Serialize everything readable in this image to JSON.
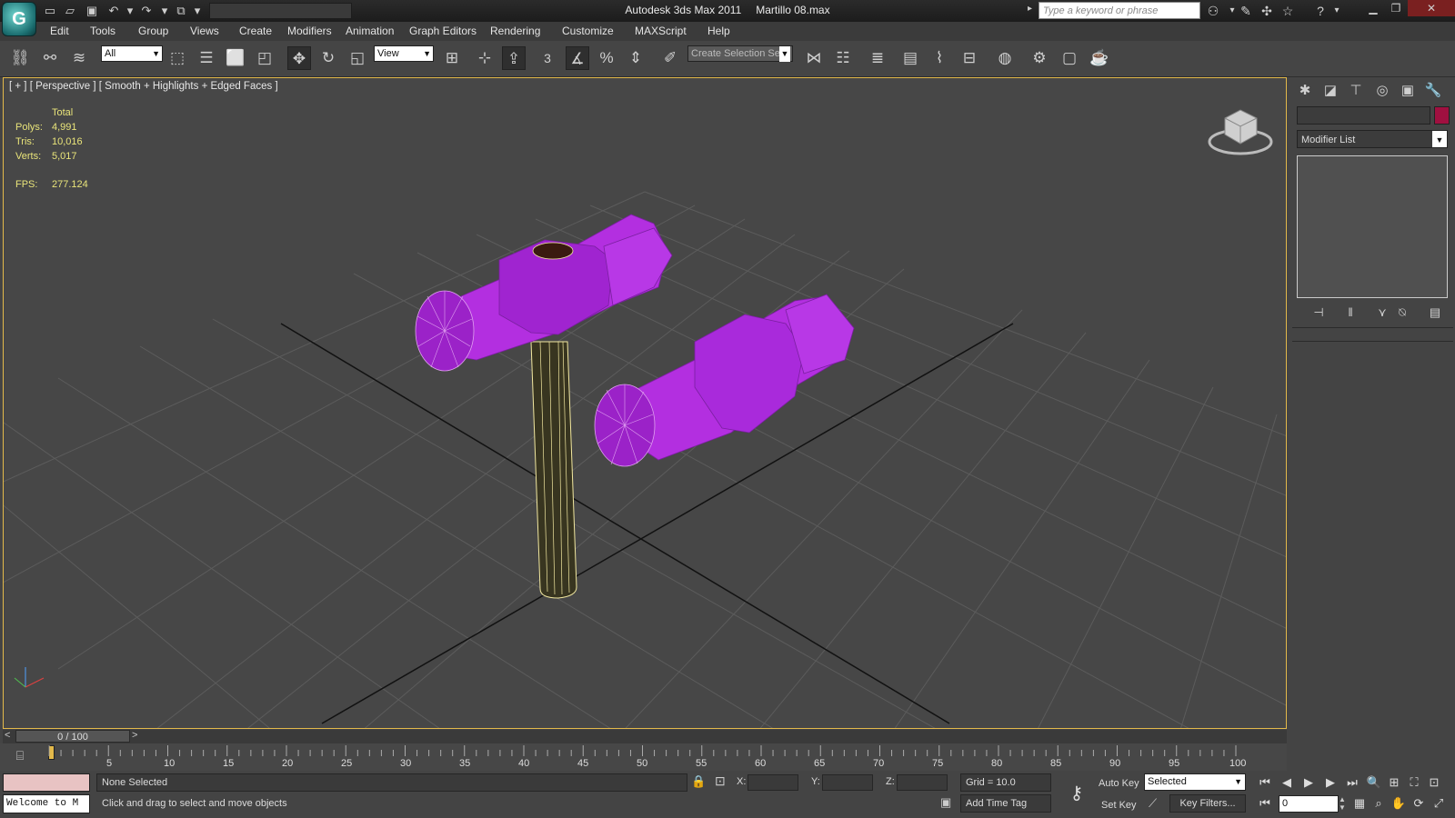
{
  "app": {
    "name": "Autodesk 3ds Max  2011",
    "file": "Martillo 08.max",
    "search_placeholder": "Type a keyword or phrase"
  },
  "menu": [
    "Edit",
    "Tools",
    "Group",
    "Views",
    "Create",
    "Modifiers",
    "Animation",
    "Graph Editors",
    "Rendering",
    "Customize",
    "MAXScript",
    "Help"
  ],
  "toolbar": {
    "selection_filter": "All",
    "ref_coord": "View",
    "snap_value": "3",
    "selection_set_placeholder": "Create Selection Se"
  },
  "viewport": {
    "label": "[ + ] [ Perspective ] [ Smooth + Highlights + Edged Faces ]",
    "stats": {
      "header": "Total",
      "polys_label": "Polys:",
      "polys": "4,991",
      "tris_label": "Tris:",
      "tris": "10,016",
      "verts_label": "Verts:",
      "verts": "5,017",
      "fps_label": "FPS:",
      "fps": "277.124"
    },
    "colors": {
      "hammer_head": "#b32fe0",
      "handle_wire": "#f2e8a0",
      "grid": "#5c5c5c",
      "border": "#e3b94a"
    }
  },
  "command_panel": {
    "modifier_list": "Modifier List",
    "object_color": "#a01040"
  },
  "time_slider": {
    "position": "0 / 100",
    "prev": "<",
    "next": ">"
  },
  "trackbar": {
    "labels": [
      "5",
      "10",
      "15",
      "20",
      "25",
      "30",
      "35",
      "40",
      "45",
      "50",
      "55",
      "60",
      "65",
      "70",
      "75",
      "80",
      "85",
      "90",
      "95",
      "100"
    ]
  },
  "status": {
    "listener": "Welcome to M",
    "selection": "None Selected",
    "prompt": "Click and drag to select and move objects",
    "x_label": "X:",
    "y_label": "Y:",
    "z_label": "Z:",
    "grid": "Grid = 10.0",
    "add_time_tag": "Add Time Tag",
    "auto_key": "Auto Key",
    "set_key": "Set Key",
    "key_mode": "Selected",
    "key_filters": "Key Filters...",
    "current_frame": "0"
  }
}
